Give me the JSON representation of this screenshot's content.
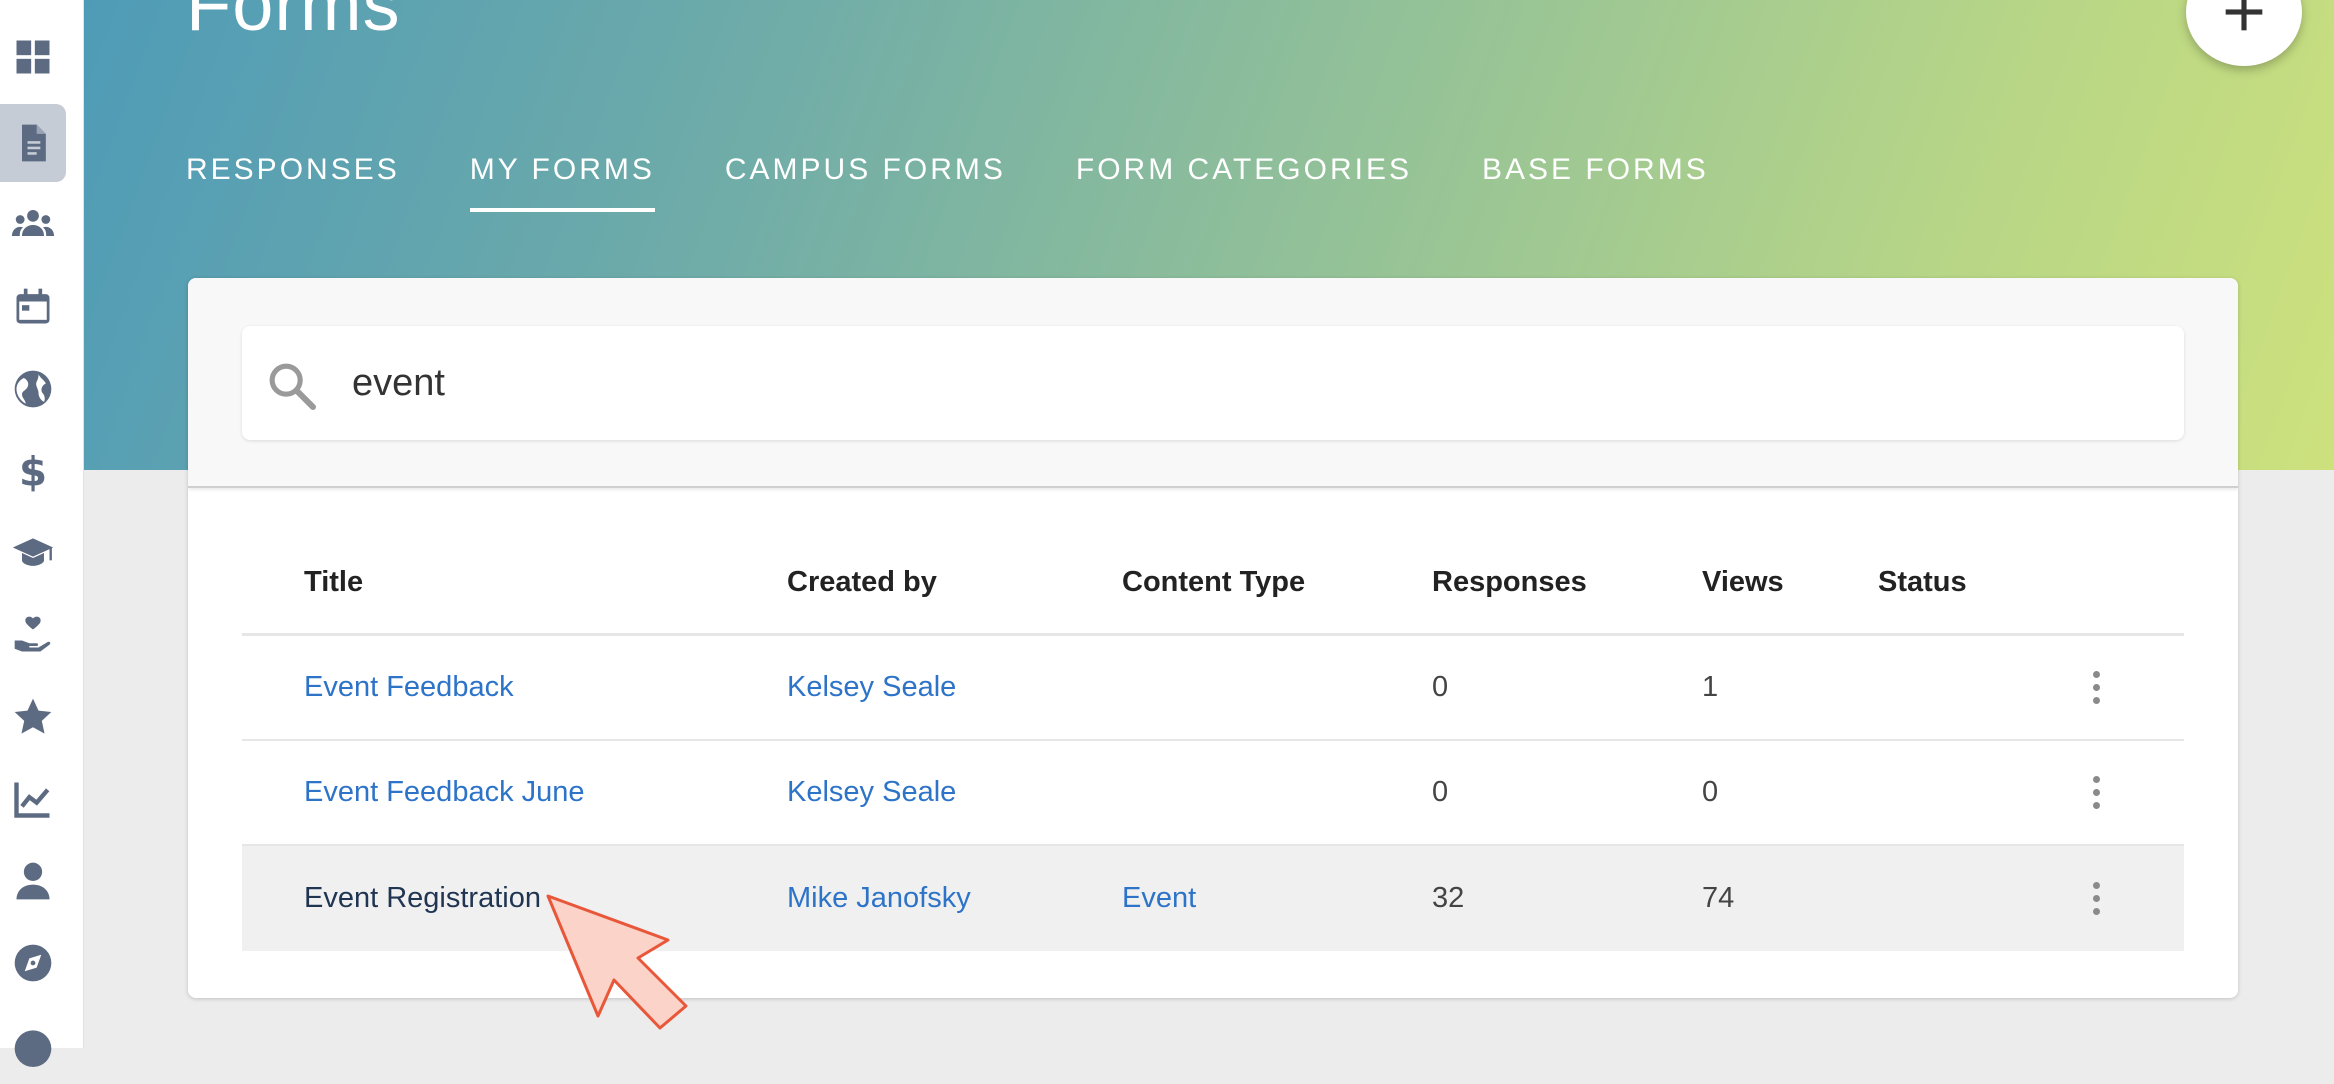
{
  "sidebar": {
    "items": [
      {
        "icon": "dashboard-icon",
        "active": false
      },
      {
        "icon": "document-icon",
        "active": true
      },
      {
        "icon": "groups-icon",
        "active": false
      },
      {
        "icon": "calendar-icon",
        "active": false
      },
      {
        "icon": "globe-icon",
        "active": false
      },
      {
        "icon": "dollar-icon",
        "active": false
      },
      {
        "icon": "graduation-cap-icon",
        "active": false
      },
      {
        "icon": "hand-heart-icon",
        "active": false
      },
      {
        "icon": "star-icon",
        "active": false
      },
      {
        "icon": "chart-icon",
        "active": false
      },
      {
        "icon": "person-icon",
        "active": false
      },
      {
        "icon": "compass-icon",
        "active": false
      }
    ]
  },
  "header": {
    "title": "Forms",
    "add_button": "+",
    "tabs": [
      {
        "label": "RESPONSES",
        "active": false
      },
      {
        "label": "MY FORMS",
        "active": true
      },
      {
        "label": "CAMPUS FORMS",
        "active": false
      },
      {
        "label": "FORM CATEGORIES",
        "active": false
      },
      {
        "label": "BASE FORMS",
        "active": false
      }
    ]
  },
  "search": {
    "value": "event",
    "icon": "search-icon"
  },
  "table": {
    "columns": [
      "Title",
      "Created by",
      "Content Type",
      "Responses",
      "Views",
      "Status"
    ],
    "rows": [
      {
        "title": "Event Feedback",
        "created_by": "Kelsey Seale",
        "content_type": "",
        "responses": "0",
        "views": "1",
        "status": ""
      },
      {
        "title": "Event Feedback June",
        "created_by": "Kelsey Seale",
        "content_type": "",
        "responses": "0",
        "views": "0",
        "status": ""
      },
      {
        "title": "Event Registration",
        "created_by": "Mike Janofsky",
        "content_type": "Event",
        "responses": "32",
        "views": "74",
        "status": ""
      }
    ]
  },
  "colors": {
    "link": "#2d73c8",
    "gradient_start": "#4f9bb7",
    "gradient_end": "#cde17d",
    "cursor": "#f15a3a"
  }
}
